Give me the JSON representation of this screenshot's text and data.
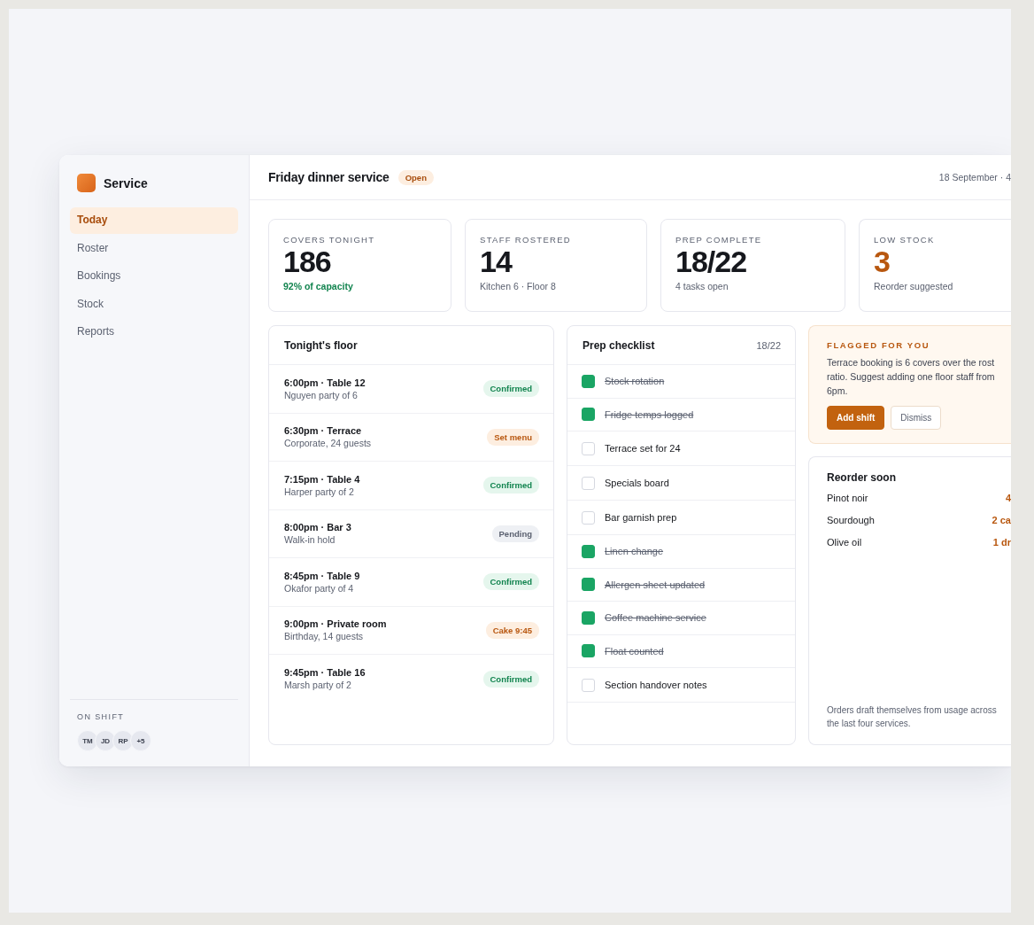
{
  "sidebar": {
    "brand": "Service",
    "nav": [
      {
        "label": "Today",
        "selected": true
      },
      {
        "label": "Roster",
        "selected": false
      },
      {
        "label": "Bookings",
        "selected": false
      },
      {
        "label": "Stock",
        "selected": false
      },
      {
        "label": "Reports",
        "selected": false
      }
    ],
    "on_shift": {
      "label": "ON SHIFT",
      "avatars": [
        "TM",
        "JD",
        "RP",
        "+5"
      ]
    }
  },
  "header": {
    "title": "Friday dinner service",
    "status": "Open",
    "date": "18 September · 4"
  },
  "stats": [
    {
      "label": "COVERS TONIGHT",
      "value": "186",
      "note": "92% of capacity",
      "kind": "positive"
    },
    {
      "label": "STAFF ROSTERED",
      "value": "14",
      "note": "Kitchen 6 · Floor 8",
      "kind": "neutral"
    },
    {
      "label": "PREP COMPLETE",
      "value": "18/22",
      "note": "4 tasks open",
      "kind": "neutral"
    },
    {
      "label": "LOW STOCK",
      "value": "3",
      "note": "Reorder suggested",
      "kind": "warning"
    }
  ],
  "floor": {
    "title": "Tonight's floor",
    "rows": [
      {
        "title": "6:00pm · Table 12",
        "detail": "Nguyen party of 6",
        "tag": "Confirmed",
        "kind": "confirmed"
      },
      {
        "title": "6:30pm · Terrace",
        "detail": "Corporate, 24 guests",
        "tag": "Set menu",
        "kind": "special"
      },
      {
        "title": "7:15pm · Table 4",
        "detail": "Harper party of 2",
        "tag": "Confirmed",
        "kind": "confirmed"
      },
      {
        "title": "8:00pm · Bar 3",
        "detail": "Walk-in hold",
        "tag": "Pending",
        "kind": "pending"
      },
      {
        "title": "8:45pm · Table 9",
        "detail": "Okafor party of 4",
        "tag": "Confirmed",
        "kind": "confirmed"
      },
      {
        "title": "9:00pm · Private room",
        "detail": "Birthday, 14 guests",
        "tag": "Cake 9:45",
        "kind": "special"
      },
      {
        "title": "9:45pm · Table 16",
        "detail": "Marsh party of 2",
        "tag": "Confirmed",
        "kind": "confirmed"
      }
    ]
  },
  "checklist": {
    "title": "Prep checklist",
    "count": "18/22",
    "items": [
      {
        "label": "Stock rotation",
        "checked": true
      },
      {
        "label": "Fridge temps logged",
        "checked": true
      },
      {
        "label": "Terrace set for 24",
        "checked": false
      },
      {
        "label": "Specials board",
        "checked": false
      },
      {
        "label": "Bar garnish prep",
        "checked": false
      },
      {
        "label": "Linen change",
        "checked": true
      },
      {
        "label": "Allergen sheet updated",
        "checked": true
      },
      {
        "label": "Coffee machine service",
        "checked": true
      },
      {
        "label": "Float counted",
        "checked": true
      },
      {
        "label": "Section handover notes",
        "checked": false
      }
    ]
  },
  "flag": {
    "title": "FLAGGED FOR YOU",
    "text": "Terrace booking is 6 covers over the rost ratio. Suggest adding one floor staff from 6pm.",
    "buttons": [
      {
        "label": "Add shift",
        "kind": "primary"
      },
      {
        "label": "Dismiss",
        "kind": "secondary"
      }
    ]
  },
  "reorder": {
    "title": "Reorder soon",
    "items": [
      {
        "name": "Pinot noir",
        "qty": "4"
      },
      {
        "name": "Sourdough",
        "qty": "2 ca"
      },
      {
        "name": "Olive oil",
        "qty": "1 dr"
      }
    ],
    "footnote": "Orders draft themselves from usage across the last four services."
  }
}
